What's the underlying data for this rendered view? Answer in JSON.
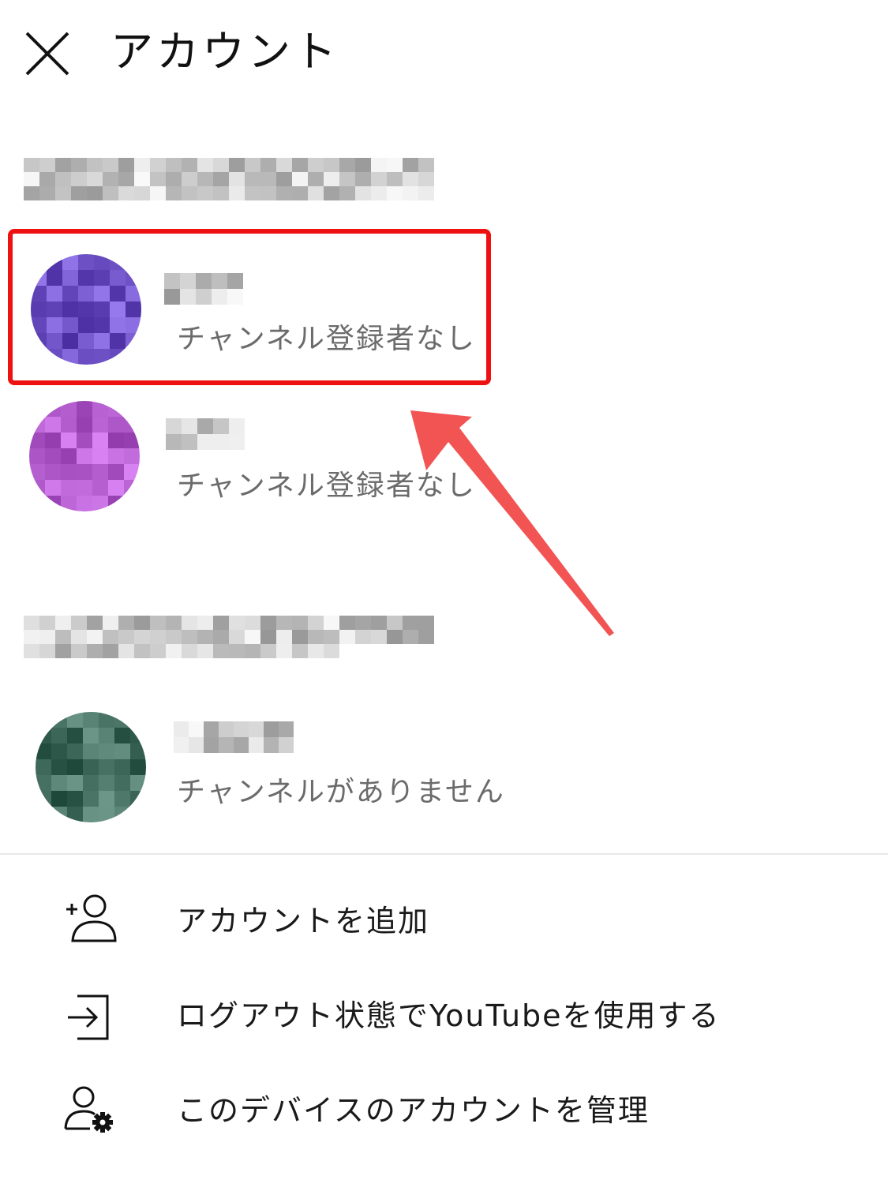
{
  "header": {
    "title": "アカウント"
  },
  "accounts": [
    {
      "subtitle": "チャンネル登録者なし",
      "highlighted": true,
      "avatar_color": "#5b3fb3"
    },
    {
      "subtitle": "チャンネル登録者なし",
      "highlighted": false,
      "avatar_color": "#a64fc0"
    },
    {
      "subtitle": "チャンネルがありません",
      "highlighted": false,
      "avatar_color": "#2f5a4c"
    }
  ],
  "menu": {
    "add_account": "アカウントを追加",
    "signed_out": "ログアウト状態でYouTubeを使用する",
    "manage": "このデバイスのアカウントを管理"
  },
  "colors": {
    "highlight": "#ee1111",
    "annotation_arrow": "#f25454"
  }
}
